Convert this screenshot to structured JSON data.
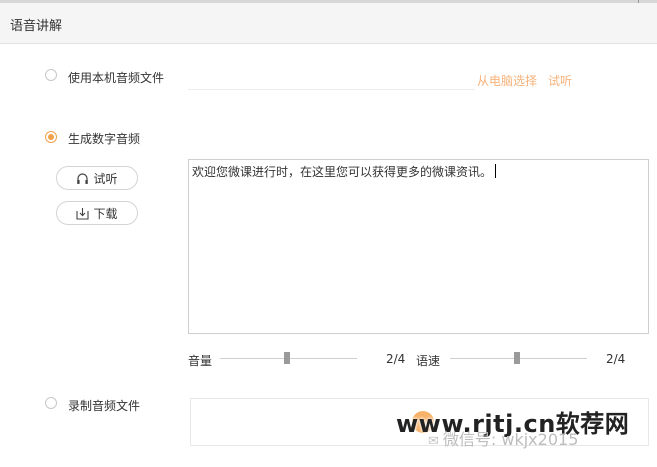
{
  "header": {
    "title": "语音讲解"
  },
  "options": {
    "local_audio": {
      "label": "使用本机音频文件",
      "selected": false
    },
    "digital_audio": {
      "label": "生成数字音频",
      "selected": true
    },
    "record_audio": {
      "label": "录制音频文件",
      "selected": false
    }
  },
  "local_links": {
    "choose": "从电脑选择",
    "preview": "试听"
  },
  "buttons": {
    "preview": "试听",
    "download": "下载"
  },
  "text_input": {
    "value": "欢迎您微课进行时，在这里您可以获得更多的微课资讯。"
  },
  "sliders": {
    "volume": {
      "label": "音量",
      "value": "2/4",
      "level": 0.5
    },
    "speed": {
      "label": "语速",
      "value": "2/4",
      "level": 0.5
    }
  },
  "watermark": {
    "site": "www.rjtj.cn软荐网",
    "wechat": "微信号: wkjx2015"
  },
  "colors": {
    "accent": "#f0a14a",
    "link": "#f6b27a"
  },
  "icons": {
    "preview": "headphones-icon",
    "download": "download-icon"
  }
}
